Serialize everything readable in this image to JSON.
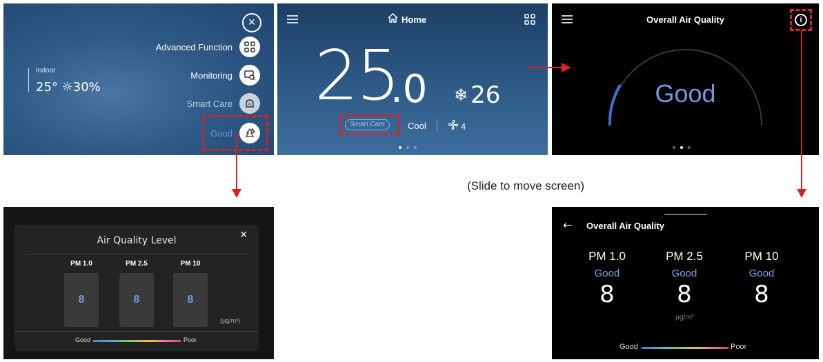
{
  "panel1": {
    "menu": [
      {
        "label": "Advanced Function",
        "icon": "grid-icon"
      },
      {
        "label": "Monitoring",
        "icon": "monitor-search-icon"
      },
      {
        "label": "Smart Care",
        "icon": "ai-icon"
      },
      {
        "label": "Good",
        "icon": "air-quality-icon"
      }
    ],
    "indoor_label": "Indoor",
    "indoor_value": "25° ☼30%"
  },
  "panel2": {
    "title": "Home",
    "temp_main": "25",
    "temp_decimal": ".0",
    "set_temp": "26",
    "mode_badge": "Smart Care",
    "mode": "Cool",
    "fan": "4"
  },
  "panel3": {
    "title": "Overall Air Quality",
    "status": "Good"
  },
  "caption": "(Slide to move screen)",
  "panel4": {
    "title": "Air Quality Level",
    "columns": [
      {
        "label": "PM 1.0",
        "value": "8"
      },
      {
        "label": "PM 2.5",
        "value": "8"
      },
      {
        "label": "PM 10",
        "value": "8"
      }
    ],
    "unit": "(µg/m³)",
    "legend_good": "Good",
    "legend_poor": "Poor"
  },
  "panel5": {
    "title": "Overall Air Quality",
    "columns": [
      {
        "label": "PM 1.0",
        "status": "Good",
        "value": "8"
      },
      {
        "label": "PM 2.5",
        "status": "Good",
        "value": "8"
      },
      {
        "label": "PM 10",
        "status": "Good",
        "value": "8"
      }
    ],
    "unit": "µg/m³",
    "legend_good": "Good",
    "legend_poor": "Poor"
  }
}
